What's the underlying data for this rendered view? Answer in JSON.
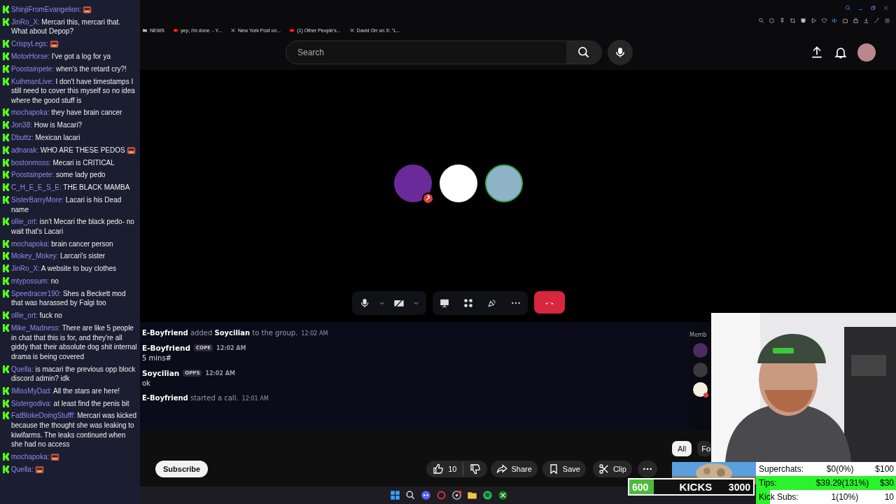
{
  "chat": [
    {
      "user": "ShinjiFromEvangelion:",
      "emote": true
    },
    {
      "user": "JinRo_X:",
      "text": "Mercari this, mercari that. What about Depop?",
      "emote": false
    },
    {
      "user": "CrispyLegs:",
      "emote": true
    },
    {
      "user": "MotorHorse:",
      "text": "I've got a log for ya",
      "emote": false
    },
    {
      "user": "Poostainpete:",
      "text": "when's the retard cry?!",
      "emote": false
    },
    {
      "user": "KuihmanLive:",
      "text": "I don't have timestamps I still need to cover this myself so no idea where the good stuff is",
      "emote": false
    },
    {
      "user": "mochapoka:",
      "text": "they have brain cancer",
      "emote": false
    },
    {
      "user": "Jon38:",
      "text": "How is Macari?",
      "emote": false
    },
    {
      "user": "Dbuttz:",
      "text": "Mexican lacari",
      "emote": false
    },
    {
      "user": "adnarak:",
      "text": "WHO ARE THESE PEDOS",
      "emote": true
    },
    {
      "user": "bostonmoss:",
      "text": "Mecari is CRITICAL",
      "emote": false
    },
    {
      "user": "Poostainpete:",
      "text": "some lady pedo",
      "emote": false
    },
    {
      "user": "C_H_E_E_S_E:",
      "text": "THE BLACK MAMBA",
      "emote": false
    },
    {
      "user": "SisterBarryMore:",
      "text": "Lacari is his Dead name",
      "emote": false
    },
    {
      "user": "ollie_ort:",
      "text": "isn't Mecari the black pedo- no wait that's Lacari",
      "emote": false
    },
    {
      "user": "mochapoka:",
      "text": "brain cancer person",
      "emote": false
    },
    {
      "user": "Mokey_Mokey:",
      "text": "Larcari's sister",
      "emote": false
    },
    {
      "user": "JinRo_X:",
      "text": "A website to buy clothes",
      "emote": false
    },
    {
      "user": "mtypossum:",
      "text": "no",
      "emote": false
    },
    {
      "user": "Speedracer190:",
      "text": "Shes a Beckett mod that was harassed by Falgi too",
      "emote": false
    },
    {
      "user": "ollie_ort:",
      "text": "fuck no",
      "emote": false
    },
    {
      "user": "Mike_Madness:",
      "text": "There are like 5 people in chat that this is for, and they're all giddy that their absolute dog shit internal drama is being covered",
      "emote": false
    },
    {
      "user": "Quella:",
      "text": "is macari the previous opp block discord admin? idk",
      "emote": false
    },
    {
      "user": "IMissMyDad:",
      "text": "All the stars are here!",
      "emote": false
    },
    {
      "user": "Sistergodiva:",
      "text": "at least find the penis bit",
      "emote": false
    },
    {
      "user": "FatBlokeDoingStufff:",
      "text": "Mercari was kicked because the thought she was leaking to kiwifarms. The leaks continued when she had no access",
      "emote": false
    },
    {
      "user": "mochapoka:",
      "emote": true
    },
    {
      "user": "Quella:",
      "emote": true
    }
  ],
  "bookmarks": [
    {
      "label": "NEWS",
      "kind": "folder"
    },
    {
      "label": "yep, i'm done. - Y...",
      "kind": "video"
    },
    {
      "label": "New York Post on...",
      "kind": "x"
    },
    {
      "label": "(1) Other People's...",
      "kind": "video"
    },
    {
      "label": "David Orr on X: \"L...",
      "kind": "x"
    }
  ],
  "search": {
    "placeholder": "Search"
  },
  "call": {
    "participants": [
      {
        "color": "#6a2a9a",
        "muted": true,
        "speaking": false
      },
      {
        "color": "#ffffff",
        "muted": false,
        "speaking": false
      },
      {
        "color": "#8fb4c8",
        "muted": false,
        "speaking": true
      }
    ]
  },
  "discord": {
    "messages": [
      {
        "kind": "system",
        "text": "**E-Boyfriend** added **Soycilian** to the group.",
        "time": "12:02 AM"
      },
      {
        "kind": "message",
        "author": "E-Boyfriend",
        "tag": "COPE",
        "time": "12:02 AM",
        "text": "5 mins#"
      },
      {
        "kind": "message",
        "author": "Soycilian",
        "tag": "OPPS",
        "time": "12:02 AM",
        "text": "ok"
      },
      {
        "kind": "system",
        "text": "**E-Boyfriend** started a call.",
        "time": "12:01 AM"
      }
    ],
    "members_header": "Memb",
    "members": [
      {
        "color": "#4a2d5e",
        "dnd": false
      },
      {
        "color": "#3a3a3a",
        "dnd": false
      },
      {
        "color": "#f2efe0",
        "dnd": true
      }
    ]
  },
  "filters": [
    {
      "label": "All",
      "selected": true
    },
    {
      "label": "Fo",
      "selected": false
    }
  ],
  "actions": {
    "subscribe": "Subscribe",
    "likes": "10",
    "share": "Share",
    "save": "Save",
    "clip": "Clip"
  },
  "kicks": {
    "current": "600",
    "label": "KICKS",
    "goal": "3000",
    "level": 0.2
  },
  "goals": [
    {
      "label": "Superchats:",
      "value": "$0(0%)",
      "goal": "$100"
    },
    {
      "label": "Tips:",
      "value": "$39.29(131%)",
      "goal": "$30",
      "level": 1
    },
    {
      "label": "Kick Subs:",
      "value": "1(10%)",
      "goal": "10",
      "level": 0.1
    }
  ]
}
